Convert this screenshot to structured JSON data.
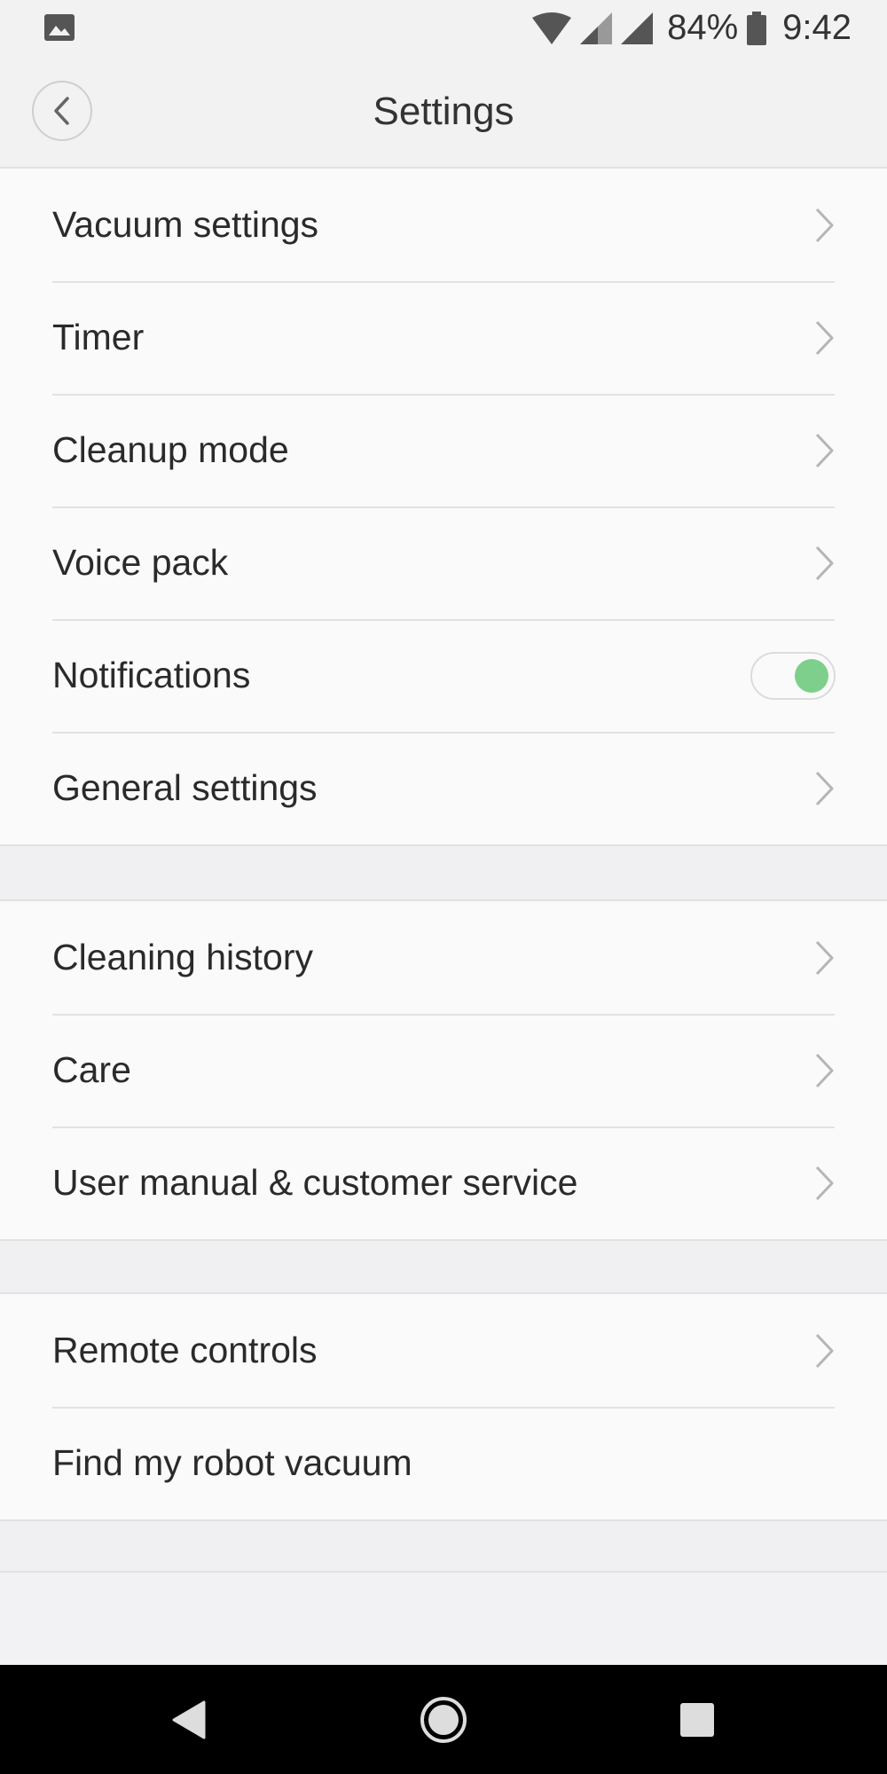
{
  "status_bar": {
    "battery": "84%",
    "time": "9:42",
    "icons": [
      "gallery-icon",
      "wifi-icon",
      "signal-icon",
      "signal-icon",
      "battery-icon"
    ]
  },
  "header": {
    "title": "Settings",
    "back_icon": "chevron-left-icon"
  },
  "groups": [
    {
      "items": [
        {
          "label": "Vacuum settings",
          "control": "chevron"
        },
        {
          "label": "Timer",
          "control": "chevron"
        },
        {
          "label": "Cleanup mode",
          "control": "chevron"
        },
        {
          "label": "Voice pack",
          "control": "chevron"
        },
        {
          "label": "Notifications",
          "control": "toggle",
          "toggle_on": true
        },
        {
          "label": "General settings",
          "control": "chevron"
        }
      ]
    },
    {
      "items": [
        {
          "label": "Cleaning history",
          "control": "chevron"
        },
        {
          "label": "Care",
          "control": "chevron"
        },
        {
          "label": "User manual & customer service",
          "control": "chevron"
        }
      ]
    },
    {
      "items": [
        {
          "label": "Remote controls",
          "control": "chevron"
        },
        {
          "label": "Find my robot vacuum",
          "control": "none"
        }
      ]
    }
  ],
  "nav_bar": {
    "icons": [
      "back-triangle-icon",
      "home-circle-icon",
      "recents-square-icon"
    ]
  },
  "colors": {
    "toggle_on": "#7dcf8b",
    "chevron": "#b5b5b5",
    "background": "#f0f0f3",
    "row_background": "#fafafa",
    "divider": "#e2e2e2"
  }
}
